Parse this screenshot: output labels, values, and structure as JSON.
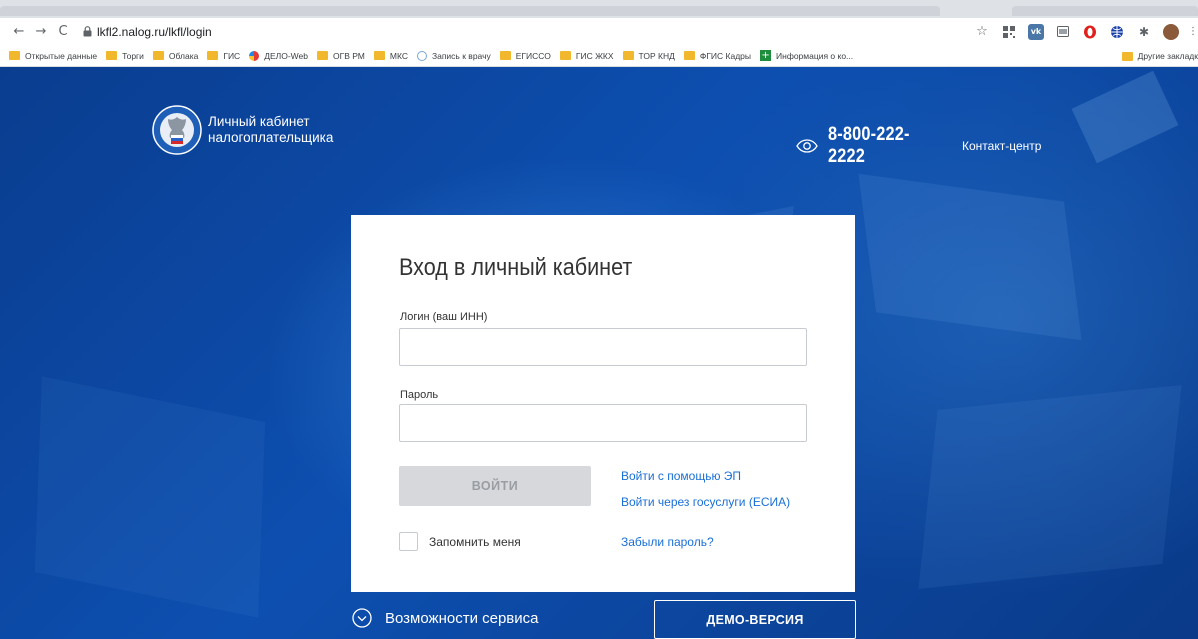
{
  "browser": {
    "url": "lkfl2.nalog.ru/lkfl/login",
    "nav": {
      "back": "←",
      "forward": "→",
      "reload": "C"
    },
    "bookmarks": [
      {
        "label": "Открытые данные",
        "icon": "folder-icon"
      },
      {
        "label": "Торги",
        "icon": "folder-icon"
      },
      {
        "label": "Облака",
        "icon": "folder-icon"
      },
      {
        "label": "ГИС",
        "icon": "folder-icon"
      },
      {
        "label": "ДЕЛО-Web",
        "icon": "delo-icon"
      },
      {
        "label": "ОГВ РМ",
        "icon": "folder-icon"
      },
      {
        "label": "МКС",
        "icon": "folder-icon"
      },
      {
        "label": "Запись к врачу",
        "icon": "doctor-icon"
      },
      {
        "label": "ЕГИССО",
        "icon": "folder-icon"
      },
      {
        "label": "ГИС ЖКХ",
        "icon": "folder-icon"
      },
      {
        "label": "ТОР КНД",
        "icon": "folder-icon"
      },
      {
        "label": "ФГИС Кадры",
        "icon": "folder-icon"
      },
      {
        "label": "Информация о ко...",
        "icon": "plus-icon"
      }
    ],
    "other_bookmarks": "Другие закладк"
  },
  "header": {
    "logo_line1": "Личный кабинет",
    "logo_line2": "налогоплательщика",
    "phone": "8-800-222-2222",
    "contact": "Контакт-центр"
  },
  "login": {
    "title": "Вход в личный кабинет",
    "login_label": "Логин (ваш ИНН)",
    "login_value": "",
    "password_label": "Пароль",
    "password_value": "",
    "submit": "ВОЙТИ",
    "link_ep": "Войти с помощью ЭП",
    "link_esia": "Войти через госуслуги (ЕСИА)",
    "remember": "Запомнить меня",
    "forgot": "Забыли пароль?"
  },
  "footer": {
    "features": "Возможности сервиса",
    "demo": "ДЕМО-ВЕРСИЯ"
  },
  "colors": {
    "page_bg": "#0b3f96",
    "link": "#1a6fd6",
    "button_disabled": "#d6d8db",
    "bookmark_folder": "#f2b82d"
  }
}
